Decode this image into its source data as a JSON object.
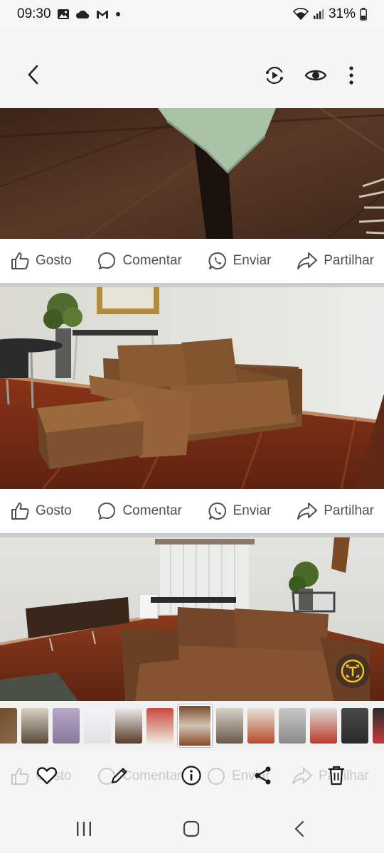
{
  "status_bar": {
    "time": "09:30",
    "battery": "31%"
  },
  "header": {
    "back_icon": "chevron-left-icon",
    "actions": [
      "motion-photo-icon",
      "eye-icon",
      "more-vertical-icon"
    ]
  },
  "posts": [
    {
      "photo": "sofa-leg-close-up",
      "actions": {
        "like": "Gosto",
        "comment": "Comentar",
        "send": "Enviar",
        "share": "Partilhar"
      }
    },
    {
      "photo": "brown-sofa-with-ottoman",
      "actions": {
        "like": "Gosto",
        "comment": "Comentar",
        "send": "Enviar",
        "share": "Partilhar"
      }
    },
    {
      "photo": "living-room-panorama"
    }
  ],
  "ghost_actions": {
    "like": "Gosto",
    "comment": "Comentar",
    "send": "Enviar",
    "share": "Partilhar"
  },
  "toolbar": [
    "heart-icon",
    "pencil-icon",
    "info-icon",
    "share-icon",
    "trash-icon"
  ],
  "nav": [
    "recents-icon",
    "home-icon",
    "back-icon"
  ],
  "colors": {
    "text": "#4b4f56",
    "divider": "#c9ccd1",
    "fab_accent": "#f5c518"
  }
}
